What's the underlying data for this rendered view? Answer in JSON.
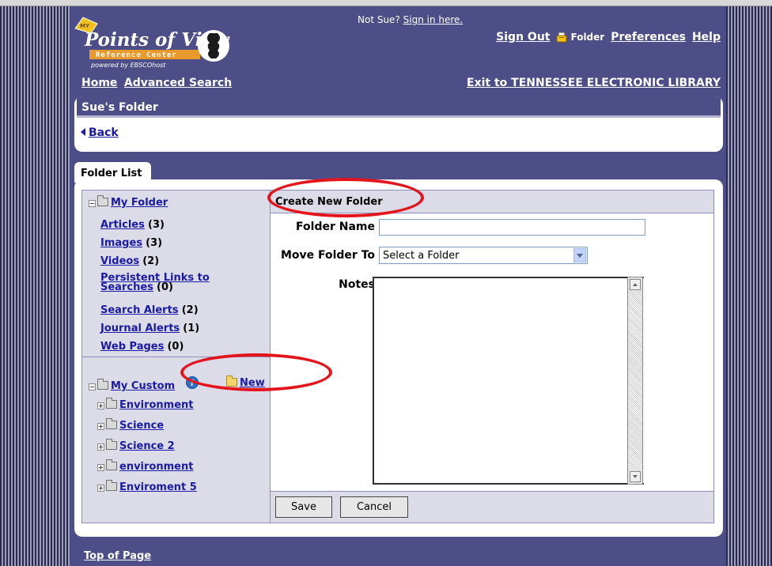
{
  "header": {
    "logo_my": "MY",
    "logo_main": "Points of View",
    "logo_sub": "Reference Center",
    "logo_powered": "powered by EBSCOhost",
    "not_user_text": "Not Sue?",
    "sign_in_link": "Sign in here.",
    "sign_out": "Sign Out",
    "folder": "Folder",
    "preferences": "Preferences",
    "help": "Help",
    "home": "Home",
    "advanced_search": "Advanced Search",
    "exit_link": "Exit to TENNESSEE ELECTRONIC LIBRARY"
  },
  "folder_panel": {
    "title": "Sue's Folder",
    "back": "Back",
    "tab_label": "Folder List"
  },
  "tree": {
    "root_label": "My Folder",
    "items": [
      {
        "label": "Articles",
        "count": "(3)"
      },
      {
        "label": "Images",
        "count": "(3)"
      },
      {
        "label": "Videos",
        "count": "(2)"
      },
      {
        "label_line1": "Persistent Links to",
        "label_line2": "Searches",
        "count": "(0)"
      },
      {
        "label": "Search Alerts",
        "count": "(2)"
      },
      {
        "label": "Journal Alerts",
        "count": "(1)"
      },
      {
        "label": "Web Pages",
        "count": "(0)"
      }
    ],
    "custom_label": "My Custom",
    "new_label": "New",
    "custom_folders": [
      "Environment",
      "Science",
      "Science 2",
      "environment",
      "Enviroment 5"
    ]
  },
  "form": {
    "heading": "Create New Folder",
    "folder_name_label": "Folder Name",
    "folder_name_value": "",
    "move_to_label": "Move Folder To",
    "move_to_selected": "Select a Folder",
    "notes_label": "Notes",
    "save": "Save",
    "cancel": "Cancel"
  },
  "footer": {
    "top_of_page": "Top of Page"
  },
  "colors": {
    "page_bg": "#4d4d88",
    "panel_bg": "#dcdce8",
    "link": "#1a1aa6",
    "annotation": "#e4141b"
  }
}
